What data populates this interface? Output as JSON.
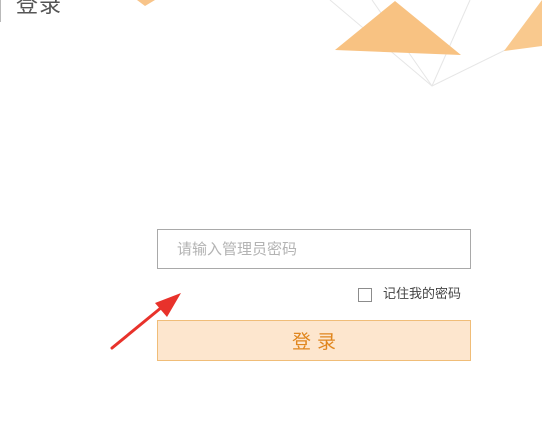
{
  "header": {
    "title": "登录"
  },
  "login_form": {
    "password_placeholder": "请输入管理员密码",
    "password_value": "",
    "remember_label": "记住我的密码",
    "remember_checked": false,
    "submit_label": "登录"
  },
  "colors": {
    "accent_orange": "#f8b565",
    "button_bg": "#fde6ce",
    "button_border": "#f0bd78",
    "button_text": "#e0861e",
    "annotation_arrow": "#e8322b"
  },
  "icons": {
    "annotation": "red-arrow-icon",
    "checkbox": "checkbox-icon"
  }
}
